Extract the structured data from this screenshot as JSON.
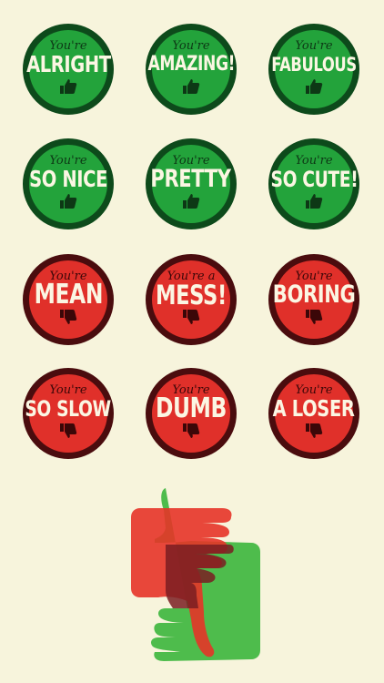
{
  "colors": {
    "background": "#f7f4dc",
    "good_fill": "#23a33b",
    "good_ring": "#0d4a1b",
    "bad_fill": "#e0302a",
    "bad_ring": "#4a0c0e",
    "text_light": "#fbf6e3"
  },
  "badges": [
    {
      "prefix": "You're",
      "word": "ALRIGHT",
      "type": "good",
      "icon": "thumbs-up-icon"
    },
    {
      "prefix": "You're",
      "word": "AMAZING!",
      "type": "good",
      "icon": "thumbs-up-icon"
    },
    {
      "prefix": "You're",
      "word": "FABULOUS",
      "type": "good",
      "icon": "thumbs-up-icon"
    },
    {
      "prefix": "You're",
      "word": "SO NICE",
      "type": "good",
      "icon": "thumbs-up-icon"
    },
    {
      "prefix": "You're",
      "word": "PRETTY",
      "type": "good",
      "icon": "thumbs-up-icon"
    },
    {
      "prefix": "You're",
      "word": "SO CUTE!",
      "type": "good",
      "icon": "thumbs-up-icon"
    },
    {
      "prefix": "You're",
      "word": "MEAN",
      "type": "bad",
      "icon": "thumbs-down-icon"
    },
    {
      "prefix": "You're a",
      "word": "MESS!",
      "type": "bad",
      "icon": "thumbs-down-icon"
    },
    {
      "prefix": "You're",
      "word": "BORING",
      "type": "bad",
      "icon": "thumbs-down-icon"
    },
    {
      "prefix": "You're",
      "word": "SO SLOW",
      "type": "bad",
      "icon": "thumbs-down-icon"
    },
    {
      "prefix": "You're",
      "word": "DUMB",
      "type": "bad",
      "icon": "thumbs-down-icon"
    },
    {
      "prefix": "You're",
      "word": "A LOSER",
      "type": "bad",
      "icon": "thumbs-down-icon"
    }
  ]
}
